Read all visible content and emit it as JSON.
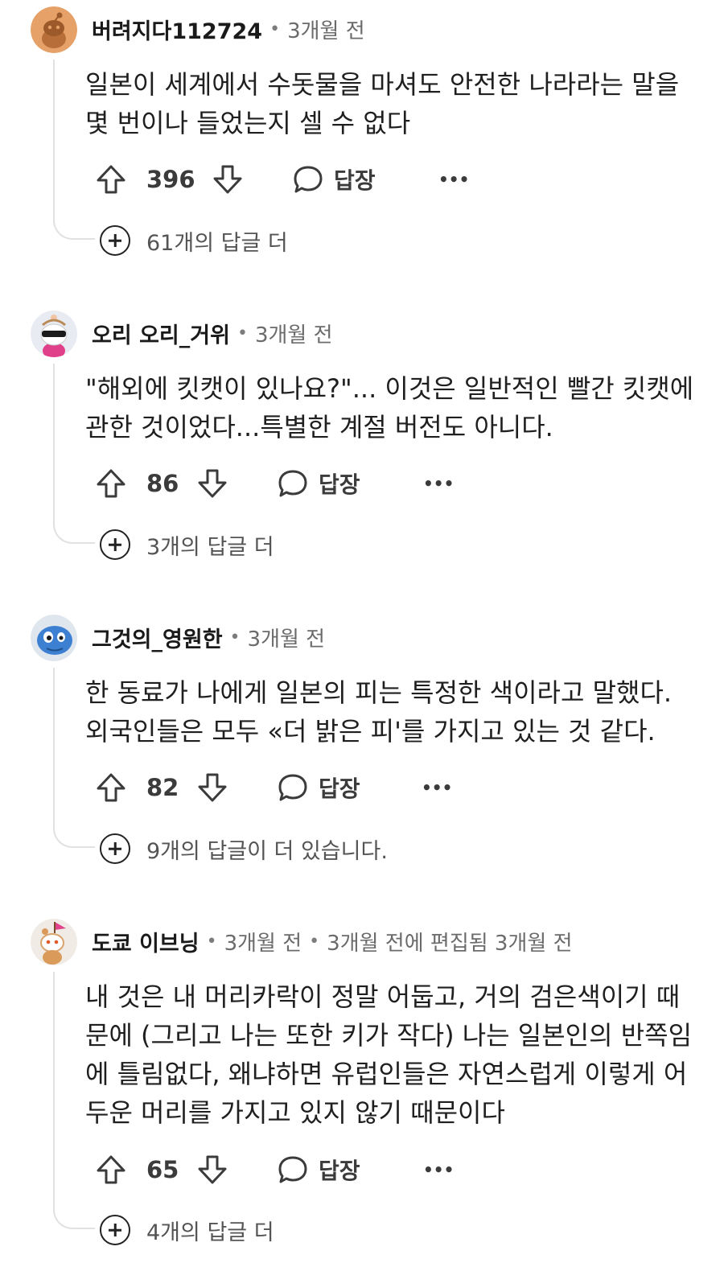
{
  "action_labels": {
    "reply": "답장",
    "more": "•••"
  },
  "comments": [
    {
      "username": "버려지다112724",
      "time": "3개월 전",
      "edited_note": "",
      "body_lines": [
        "일본이 세계에서 수돗물을 마셔도 안전한 나라라는 말을",
        "몇 번이나 들었는지 셀 수 없다"
      ],
      "votes": "396",
      "more_replies": "61개의 답글 더",
      "avatar_color": "#e39b5b"
    },
    {
      "username": "오리 오리_거위",
      "time": "3개월 전",
      "edited_note": "",
      "body_lines": [
        "\"해외에 킷캣이 있나요?\"... 이것은 일반적인 빨간 킷캣에",
        "관한 것이었다...특별한 계절 버전도 아니다."
      ],
      "votes": "86",
      "more_replies": "3개의 답글 더",
      "avatar_color": "#d8dbe8"
    },
    {
      "username": "그것의_영원한",
      "time": "3개월 전",
      "edited_note": "",
      "body_lines": [
        "한 동료가 나에게 일본의 피는 특정한 색이라고 말했다.",
        "외국인들은 모두 «더 밝은 피'를 가지고 있는 것 같다."
      ],
      "votes": "82",
      "more_replies": "9개의 답글이 더 있습니다.",
      "avatar_color": "#3e7fcf"
    },
    {
      "username": "도쿄 이브닝",
      "time": "3개월 전",
      "edited_note": "3개월 전에 편집됨 3개월 전",
      "body_lines": [
        "내 것은 내 머리카락이 정말 어둡고, 거의 검은색이기 때",
        "문에 (그리고 나는 또한 키가 작다) 나는 일본인의 반쪽임",
        "에 틀림없다, 왜냐하면 유럽인들은 자연스럽게 이렇게 어",
        "두운 머리를 가지고 있지 않기 때문이다"
      ],
      "votes": "65",
      "more_replies": "4개의 답글 더",
      "avatar_color": "#eedfd0"
    }
  ]
}
